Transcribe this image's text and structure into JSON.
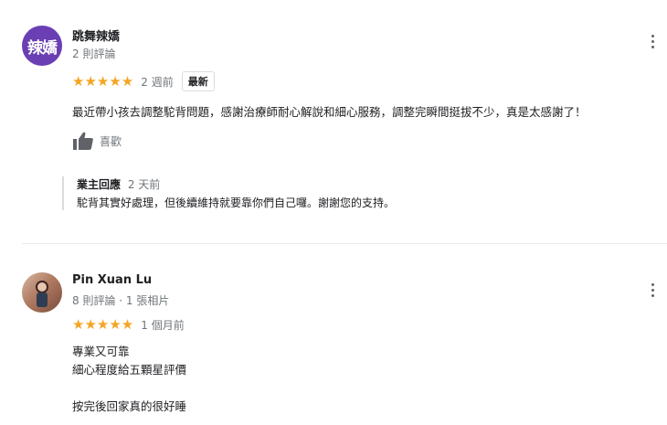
{
  "reviews": [
    {
      "avatar_text": "辣嬌",
      "name": "跳舞辣嬌",
      "meta": "2 則評論",
      "stars": "★★★★★",
      "time": "2 週前",
      "badge": "最新",
      "text": "最近帶小孩去調整駝背問題，感謝治療師耐心解說和細心服務，調整完瞬間挺拔不少，真是太感謝了！",
      "like_label": "喜歡",
      "reply": {
        "owner": "業主回應",
        "time": "2 天前",
        "text": "駝背其實好處理，但後續維持就要靠你們自己囉。謝謝您的支持。"
      }
    },
    {
      "name": "Pin Xuan Lu",
      "meta": "8 則評論 · 1 張相片",
      "stars": "★★★★★",
      "time": "1 個月前",
      "text_lines": [
        "專業又可靠",
        "細心程度給五顆星評價",
        "",
        "按完後回家真的很好睡"
      ]
    }
  ],
  "colors": {
    "star": "#f4a523",
    "avatar_bg": "#6a3fb3"
  }
}
